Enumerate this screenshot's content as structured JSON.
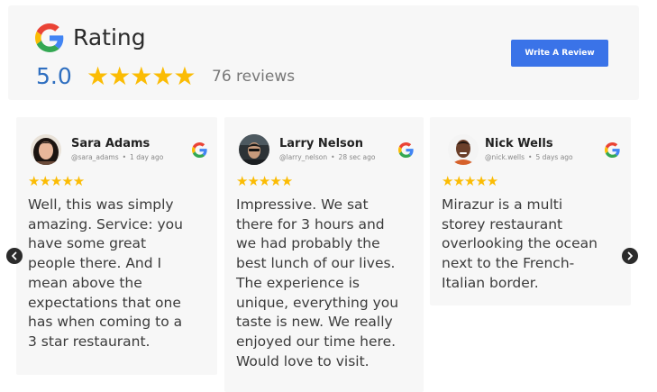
{
  "header": {
    "title": "Rating",
    "score": "5.0",
    "stars": "★★★★★",
    "review_count": "76 reviews",
    "write_button": "Write A Review"
  },
  "colors": {
    "accent": "#3a73e8",
    "score": "#2f6fc0",
    "star": "#fbbc04",
    "card_background": "#f7f7f7"
  },
  "icons": {
    "google": "google-g-icon",
    "prev": "chevron-left-icon",
    "next": "chevron-right-icon"
  },
  "reviews": [
    {
      "name": "Sara Adams",
      "handle": "@sara_adams",
      "time": "1 day ago",
      "stars": "★★★★★",
      "rating": 5,
      "text_lines": [
        "Well, this was simply",
        "amazing. Service: you",
        "have some great",
        "people there. And I",
        "mean above the",
        "expectations that one",
        "has when coming to a",
        "3 star restaurant."
      ]
    },
    {
      "name": "Larry Nelson",
      "handle": "@larry_nelson",
      "time": "28 sec ago",
      "stars": "★★★★★",
      "rating": 5,
      "text_lines": [
        "Impressive. We sat",
        "there for 3 hours and",
        "we had probably the",
        "best lunch of our lives.",
        "The experience is",
        "unique, everything you",
        "taste is new. We really",
        "enjoyed our time here.",
        "Would love to visit."
      ]
    },
    {
      "name": "Nick Wells",
      "handle": "@nick.wells",
      "time": "5 days ago",
      "stars": "★★★★★",
      "rating": 5,
      "text_lines": [
        "Mirazur is a multi",
        "storey restaurant",
        "overlooking the ocean",
        "next to the French-",
        "Italian border."
      ]
    }
  ]
}
